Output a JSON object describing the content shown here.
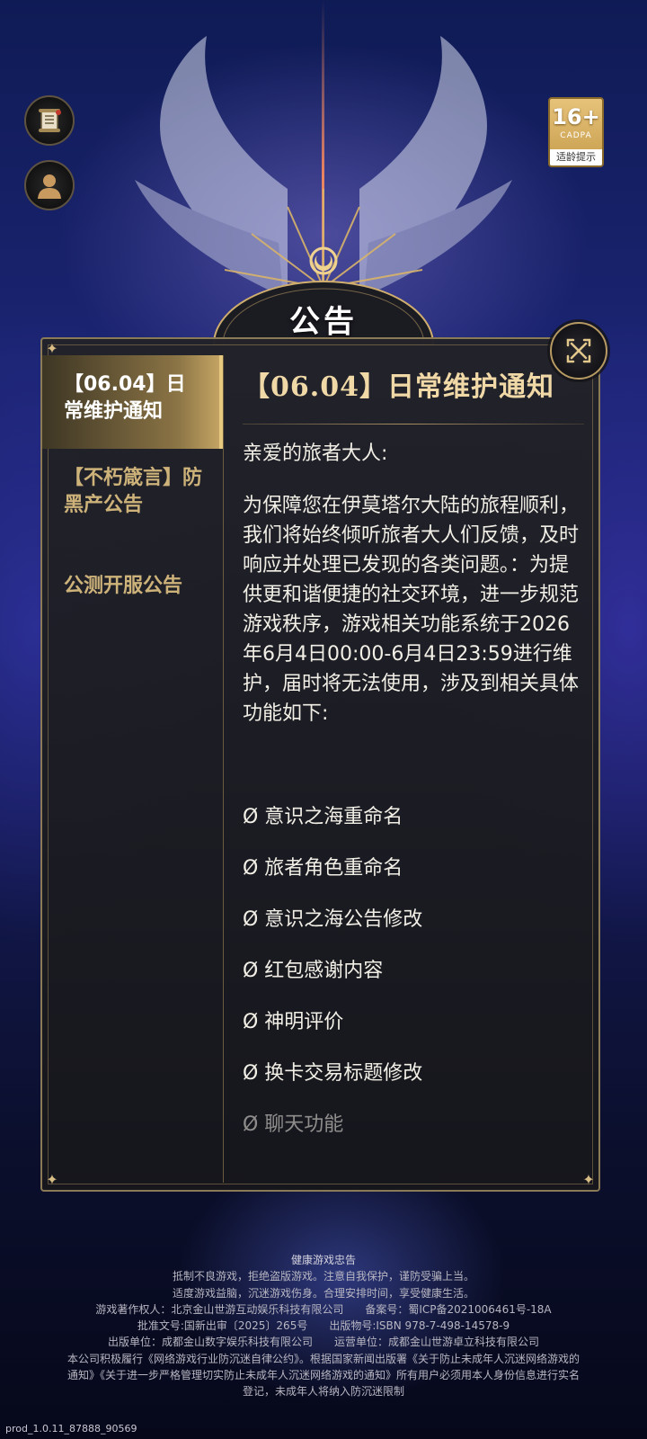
{
  "header": {
    "title": "公告",
    "age_badge": {
      "rating": "16+",
      "org": "CADPA",
      "tip": "适龄提示"
    }
  },
  "icons": {
    "top_left_1": "scroll-icon",
    "top_left_2": "avatar-icon",
    "close": "close-icon"
  },
  "sidebar": {
    "items": [
      {
        "label": "【06.04】日常维护通知",
        "active": true
      },
      {
        "label": "【不朽箴言】防黑产公告",
        "active": false
      },
      {
        "label": "公测开服公告",
        "active": false
      }
    ]
  },
  "content": {
    "title": "【06.04】日常维护通知",
    "greeting": "亲爱的旅者大人:",
    "body": "为保障您在伊莫塔尔大陆的旅程顺利，我们将始终倾听旅者大人们反馈，及时响应并处理已发现的各类问题。：为提供更和谐便捷的社交环境，进一步规范游戏秩序，游戏相关功能系统于2026年6月4日00:00-6月4日23:59进行维护，届时将无法使用，涉及到相关具体功能如下:",
    "items": [
      "Ø 意识之海重命名",
      "Ø 旅者角色重命名",
      "Ø 意识之海公告修改",
      "Ø 红包感谢内容",
      "Ø 神明评价",
      "Ø 换卡交易标题修改",
      "Ø 聊天功能"
    ]
  },
  "footer": {
    "lines": [
      "健康游戏忠告",
      "抵制不良游戏，拒绝盗版游戏。注意自我保护，谨防受骗上当。",
      "适度游戏益脑，沉迷游戏伤身。合理安排时间，享受健康生活。",
      "游戏著作权人：北京金山世游互动娱乐科技有限公司　　备案号：蜀ICP备2021006461号-18A",
      "批准文号:国新出审〔2025〕265号　　出版物号:ISBN 978-7-498-14578-9",
      "出版单位：成都金山数字娱乐科技有限公司　　运营单位：成都金山世游卓立科技有限公司",
      "本公司积极履行《网络游戏行业防沉迷自律公约》。根据国家新闻出版署《关于防止未成年人沉迷网络游戏的",
      "通知》《关于进一步严格管理切实防止未成年人沉迷网络游戏的通知》所有用户必须用本人身份信息进行实名",
      "登记，未成年人将纳入防沉迷限制"
    ],
    "version": "prod_1.0.11_87888_90569"
  }
}
